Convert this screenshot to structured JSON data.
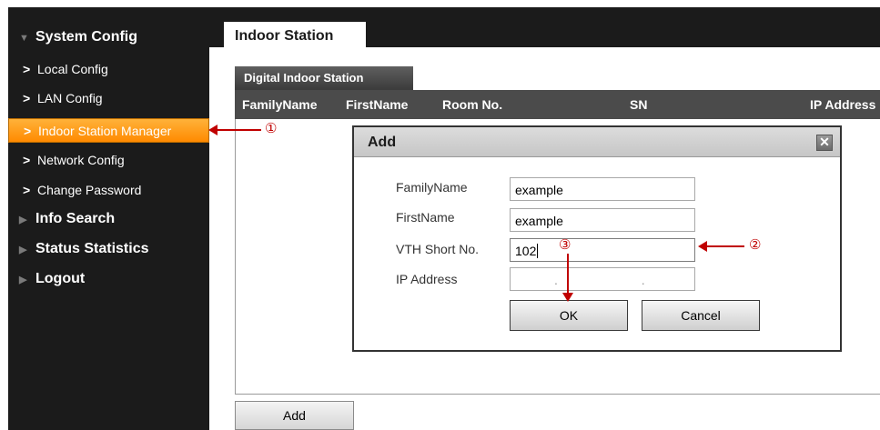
{
  "sidebar": {
    "groups": [
      {
        "label": "System Config",
        "expanded": true
      },
      {
        "label": "Info Search",
        "expanded": false
      },
      {
        "label": "Status Statistics",
        "expanded": false
      },
      {
        "label": "Logout",
        "expanded": false
      }
    ],
    "items": [
      {
        "label": "Local Config"
      },
      {
        "label": "LAN Config"
      },
      {
        "label": "Indoor Station Manager",
        "active": true
      },
      {
        "label": "Network Config"
      },
      {
        "label": "Change Password"
      }
    ]
  },
  "header": {
    "tab": "Indoor Station"
  },
  "main": {
    "subtab": "Digital Indoor Station",
    "columns": [
      "FamilyName",
      "FirstName",
      "Room No.",
      "SN",
      "IP Address"
    ],
    "add_label": "Add"
  },
  "dialog": {
    "title": "Add",
    "close_glyph": "✕",
    "fields": {
      "family_name": {
        "label": "FamilyName",
        "value": "example"
      },
      "first_name": {
        "label": "FirstName",
        "value": "example"
      },
      "vth_short_no": {
        "label": "VTH Short No.",
        "value": "102"
      },
      "ip_address": {
        "label": "IP Address",
        "value": ". . ."
      }
    },
    "ok_label": "OK",
    "cancel_label": "Cancel"
  },
  "annotations": {
    "one": "①",
    "two": "②",
    "three": "③"
  },
  "colors": {
    "sidebar_bg": "#1b1b1b",
    "active_item": "#ff9a1a",
    "annotation": "#c00000"
  }
}
